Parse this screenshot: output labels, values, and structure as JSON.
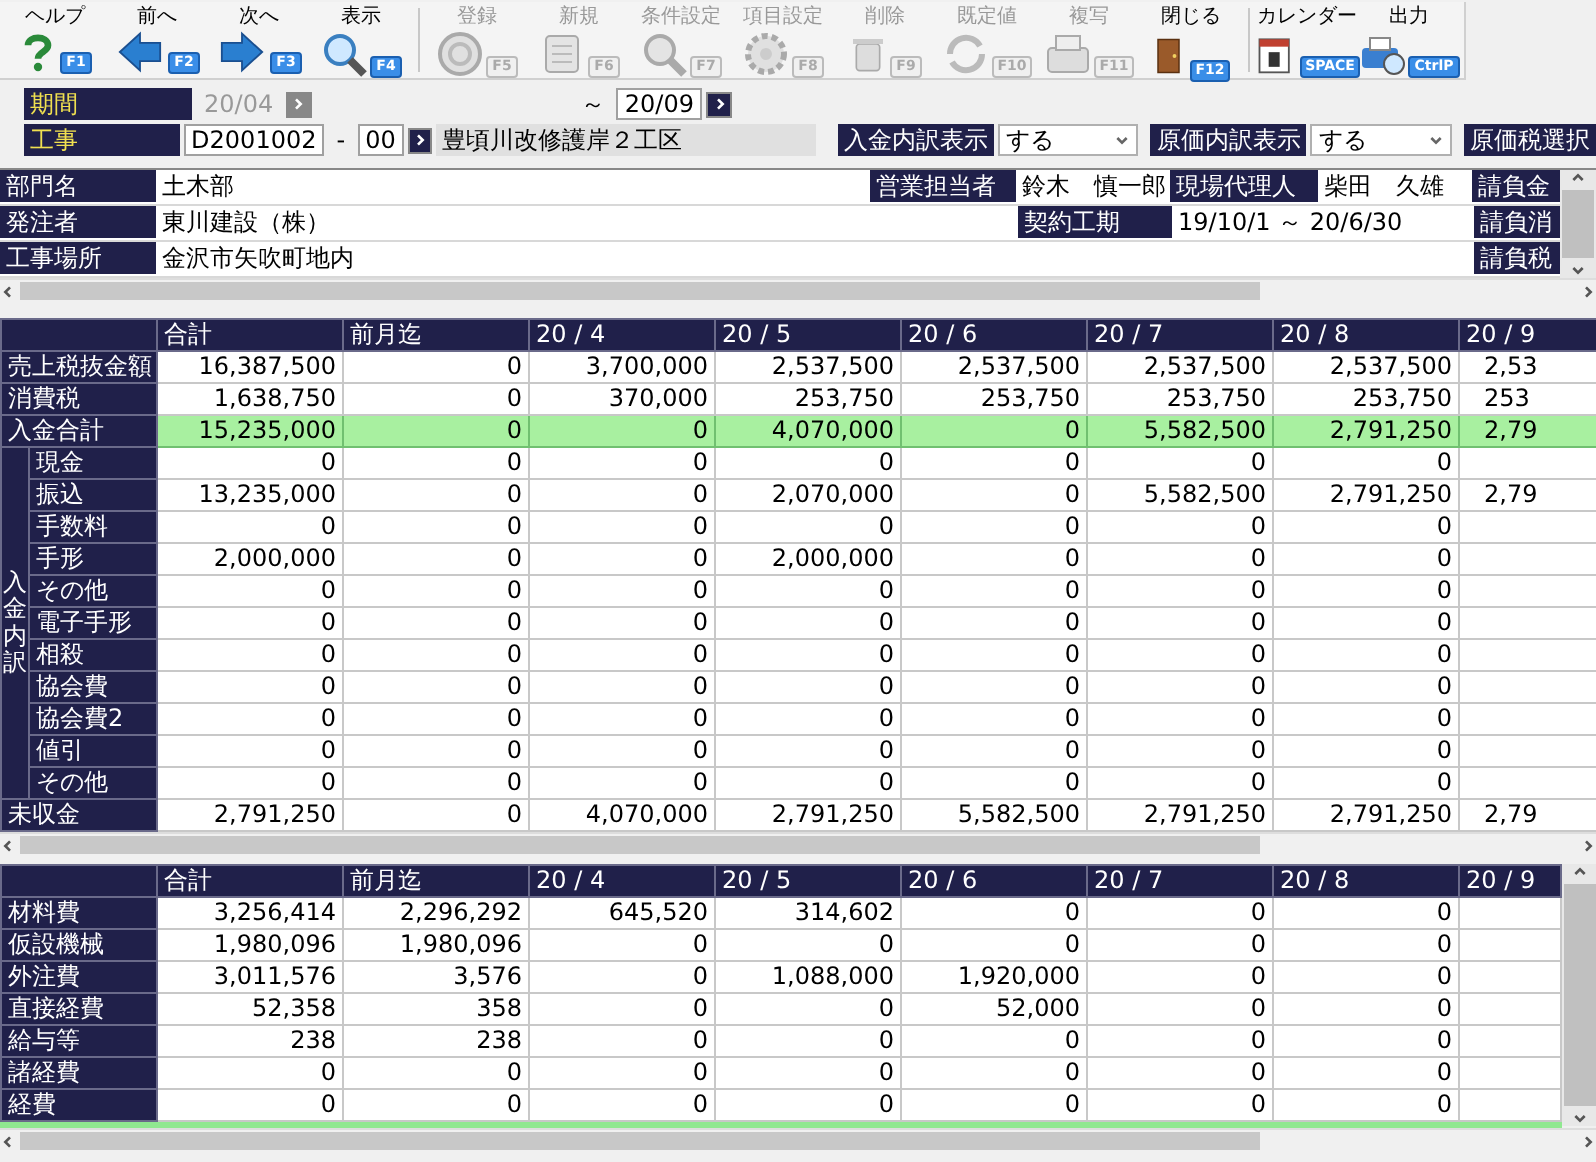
{
  "toolbar": {
    "groups": [
      {
        "buttons": [
          {
            "label": "ヘルプ",
            "key": "F1",
            "kind": "help",
            "disabled": false
          },
          {
            "label": "前へ",
            "key": "F2",
            "kind": "back",
            "disabled": false
          },
          {
            "label": "次へ",
            "key": "F3",
            "kind": "forward",
            "disabled": false
          },
          {
            "label": "表示",
            "key": "F4",
            "kind": "search",
            "disabled": false
          }
        ]
      },
      {
        "buttons": [
          {
            "label": "登録",
            "key": "F5",
            "kind": "register",
            "disabled": true
          },
          {
            "label": "新規",
            "key": "F6",
            "kind": "new",
            "disabled": true
          },
          {
            "label": "条件設定",
            "key": "F7",
            "kind": "condition",
            "disabled": true
          },
          {
            "label": "項目設定",
            "key": "F8",
            "kind": "items",
            "disabled": true
          },
          {
            "label": "削除",
            "key": "F9",
            "kind": "delete",
            "disabled": true
          },
          {
            "label": "既定値",
            "key": "F10",
            "kind": "default",
            "disabled": true
          },
          {
            "label": "複写",
            "key": "F11",
            "kind": "copy",
            "disabled": true
          },
          {
            "label": "閉じる",
            "key": "F12",
            "kind": "close",
            "disabled": false
          }
        ]
      },
      {
        "buttons": [
          {
            "label": "カレンダー",
            "key": "SPACE",
            "kind": "calendar",
            "disabled": false
          },
          {
            "label": "出力",
            "key": "CtrlP",
            "kind": "print",
            "disabled": false
          }
        ]
      }
    ]
  },
  "period": {
    "label": "期間",
    "from": {
      "value": "20/04",
      "disabled": true
    },
    "separator": "～",
    "to": {
      "value": "20/09",
      "disabled": false
    }
  },
  "project": {
    "label": "工事",
    "code": "D2001002",
    "separator": "-",
    "branch": "00",
    "name": "豊頃川改修護岸２工区"
  },
  "options": [
    {
      "label": "入金内訳表示",
      "value": "する"
    },
    {
      "label": "原価内訳表示",
      "value": "する"
    }
  ],
  "tax_option": {
    "label": "原価税選択"
  },
  "info": {
    "rows": [
      {
        "fields": [
          {
            "label": "部門名",
            "value": "土木部"
          },
          {
            "label": "営業担当者",
            "value": "鈴木　慎一郎"
          },
          {
            "label": "現場代理人",
            "value": "柴田　久雄"
          }
        ],
        "edge_label": "請負金"
      },
      {
        "fields": [
          {
            "label": "発注者",
            "value": "東川建設（株）"
          },
          {
            "label": "契約工期",
            "value": "19/10/1 ～ 20/6/30"
          }
        ],
        "edge_label": "請負消"
      },
      {
        "fields": [
          {
            "label": "工事場所",
            "value": "金沢市矢吹町地内"
          }
        ],
        "edge_label": "請負税"
      }
    ]
  },
  "receipts": {
    "columns": [
      "合計",
      "前月迄",
      "20 / 4",
      "20 / 5",
      "20 / 6",
      "20 / 7",
      "20 / 8",
      "20 / 9"
    ],
    "rows": [
      {
        "label": "売上税抜金額",
        "highlighted": false,
        "values": [
          "16,387,500",
          "0",
          "3,700,000",
          "2,537,500",
          "2,537,500",
          "2,537,500",
          "2,537,500",
          "2,53"
        ]
      },
      {
        "label": "消費税",
        "highlighted": false,
        "values": [
          "1,638,750",
          "0",
          "370,000",
          "253,750",
          "253,750",
          "253,750",
          "253,750",
          "253"
        ]
      },
      {
        "label": "入金合計",
        "highlighted": true,
        "values": [
          "15,235,000",
          "0",
          "0",
          "4,070,000",
          "0",
          "5,582,500",
          "2,791,250",
          "2,79"
        ]
      },
      {
        "label": "入金内訳",
        "children": [
          {
            "label": "現金",
            "highlighted": false,
            "values": [
              "0",
              "0",
              "0",
              "0",
              "0",
              "0",
              "0"
            ]
          },
          {
            "label": "振込",
            "highlighted": false,
            "values": [
              "13,235,000",
              "0",
              "0",
              "2,070,000",
              "0",
              "5,582,500",
              "2,791,250",
              "2,79"
            ]
          },
          {
            "label": "手数料",
            "highlighted": false,
            "values": [
              "0",
              "0",
              "0",
              "0",
              "0",
              "0",
              "0"
            ]
          },
          {
            "label": "手形",
            "highlighted": false,
            "values": [
              "2,000,000",
              "0",
              "0",
              "2,000,000",
              "0",
              "0",
              "0"
            ]
          },
          {
            "label": "その他",
            "highlighted": false,
            "values": [
              "0",
              "0",
              "0",
              "0",
              "0",
              "0",
              "0"
            ]
          },
          {
            "label": "電子手形",
            "highlighted": false,
            "values": [
              "0",
              "0",
              "0",
              "0",
              "0",
              "0",
              "0"
            ]
          },
          {
            "label": "相殺",
            "highlighted": false,
            "values": [
              "0",
              "0",
              "0",
              "0",
              "0",
              "0",
              "0"
            ]
          },
          {
            "label": "協会費",
            "highlighted": false,
            "values": [
              "0",
              "0",
              "0",
              "0",
              "0",
              "0",
              "0"
            ]
          },
          {
            "label": "協会費2",
            "highlighted": false,
            "values": [
              "0",
              "0",
              "0",
              "0",
              "0",
              "0",
              "0"
            ]
          },
          {
            "label": "値引",
            "highlighted": false,
            "values": [
              "0",
              "0",
              "0",
              "0",
              "0",
              "0",
              "0"
            ]
          },
          {
            "label": "その他",
            "highlighted": false,
            "values": [
              "0",
              "0",
              "0",
              "0",
              "0",
              "0",
              "0"
            ]
          }
        ]
      },
      {
        "label": "未収金",
        "highlighted": false,
        "values": [
          "2,791,250",
          "0",
          "4,070,000",
          "2,791,250",
          "5,582,500",
          "2,791,250",
          "2,791,250",
          "2,79"
        ]
      }
    ]
  },
  "costs": {
    "columns": [
      "合計",
      "前月迄",
      "20 / 4",
      "20 / 5",
      "20 / 6",
      "20 / 7",
      "20 / 8",
      "20 / 9"
    ],
    "rows": [
      {
        "label": "材料費",
        "highlighted": false,
        "values": [
          "3,256,414",
          "2,296,292",
          "645,520",
          "314,602",
          "0",
          "0",
          "0"
        ]
      },
      {
        "label": "仮設機械",
        "highlighted": false,
        "values": [
          "1,980,096",
          "1,980,096",
          "0",
          "0",
          "0",
          "0",
          "0"
        ]
      },
      {
        "label": "外注費",
        "highlighted": false,
        "values": [
          "3,011,576",
          "3,576",
          "0",
          "1,088,000",
          "1,920,000",
          "0",
          "0"
        ]
      },
      {
        "label": "直接経費",
        "highlighted": false,
        "values": [
          "52,358",
          "358",
          "0",
          "0",
          "52,000",
          "0",
          "0"
        ]
      },
      {
        "label": "給与等",
        "highlighted": false,
        "values": [
          "238",
          "238",
          "0",
          "0",
          "0",
          "0",
          "0"
        ]
      },
      {
        "label": "諸経費",
        "highlighted": false,
        "values": [
          "0",
          "0",
          "0",
          "0",
          "0",
          "0",
          "0"
        ]
      },
      {
        "label": "経費",
        "highlighted": false,
        "values": [
          "0",
          "0",
          "0",
          "0",
          "0",
          "0",
          "0"
        ]
      }
    ]
  }
}
